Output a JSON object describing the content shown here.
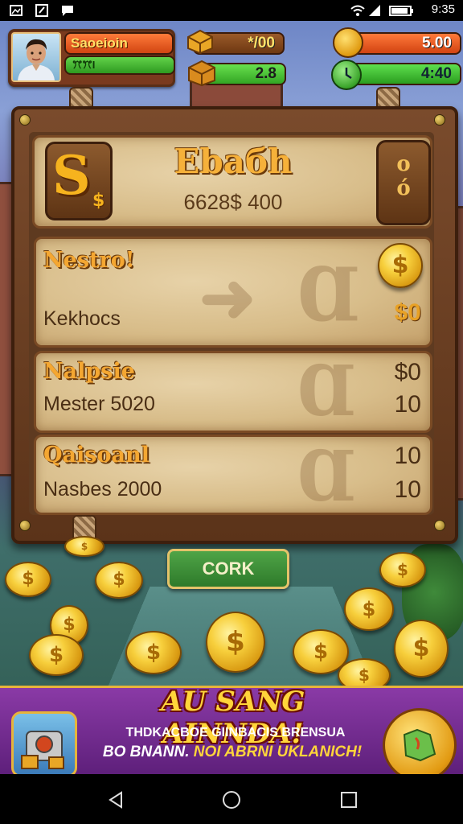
{
  "status_bar": {
    "time": "9:35",
    "left_icons": [
      "gallery-icon",
      "edit-icon",
      "message-icon"
    ],
    "right_icons": [
      "wifi-icon",
      "signal-icon",
      "battery-icon"
    ]
  },
  "hud": {
    "player_name": "Saoeioin",
    "level_label": "ꔫꔫI",
    "gold": "*/00",
    "gems": "2.8",
    "energy": "5.00",
    "timer": "4:40"
  },
  "board": {
    "title": "Ebaбh",
    "subtitle": "6628$ 400",
    "currency_glyph": "S",
    "currency_glyph_small": "$",
    "side_icon_top": "o",
    "side_icon_bottom": "ó",
    "rows": [
      {
        "title": "Nestro!",
        "subtitle": "Kekhocs",
        "value_top": "",
        "value_bottom": "$0",
        "has_coin": true
      },
      {
        "title": "Nalpsie",
        "subtitle": "Mester 5020",
        "value_top": "$0",
        "value_bottom": "10",
        "has_coin": false
      },
      {
        "title": "Qaisoanl",
        "subtitle": "Nasbes 2000",
        "value_top": "10",
        "value_bottom": "10",
        "has_coin": false
      }
    ]
  },
  "action_button": "CORK",
  "coin_symbol": "$",
  "promo": {
    "headline": "AU SANG AINNDA!",
    "line1": "THDKACBOE GIINBACIS BRENSUA",
    "line2_a": "BO BNANN.",
    "line2_b": "NOI ABRNI UKLANICH!"
  },
  "nav": {
    "back": "back-button",
    "home": "home-button",
    "recents": "recents-button"
  },
  "colors": {
    "wood": "#7a4b2c",
    "parchment": "#d8bd8a",
    "gold_text": "#f4a732",
    "promo_purple": "#7a2f98",
    "button_green": "#3f9a3a"
  }
}
